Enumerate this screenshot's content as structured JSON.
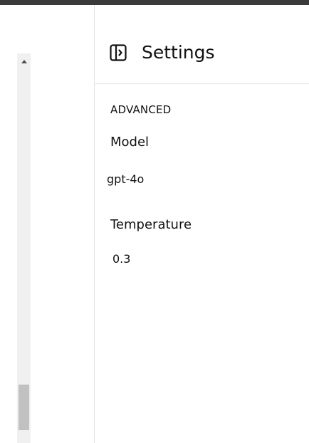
{
  "settings": {
    "title": "Settings",
    "toggle_icon": "sidebar-toggle-icon",
    "section": "ADVANCED",
    "model": {
      "label": "Model",
      "value": "gpt-4o"
    },
    "temperature": {
      "label": "Temperature",
      "value": "0.3"
    }
  },
  "colors": {
    "topbar": "#3a3a3a",
    "scroll_track": "#f0f0f0",
    "scroll_thumb": "#c1c1c1"
  }
}
